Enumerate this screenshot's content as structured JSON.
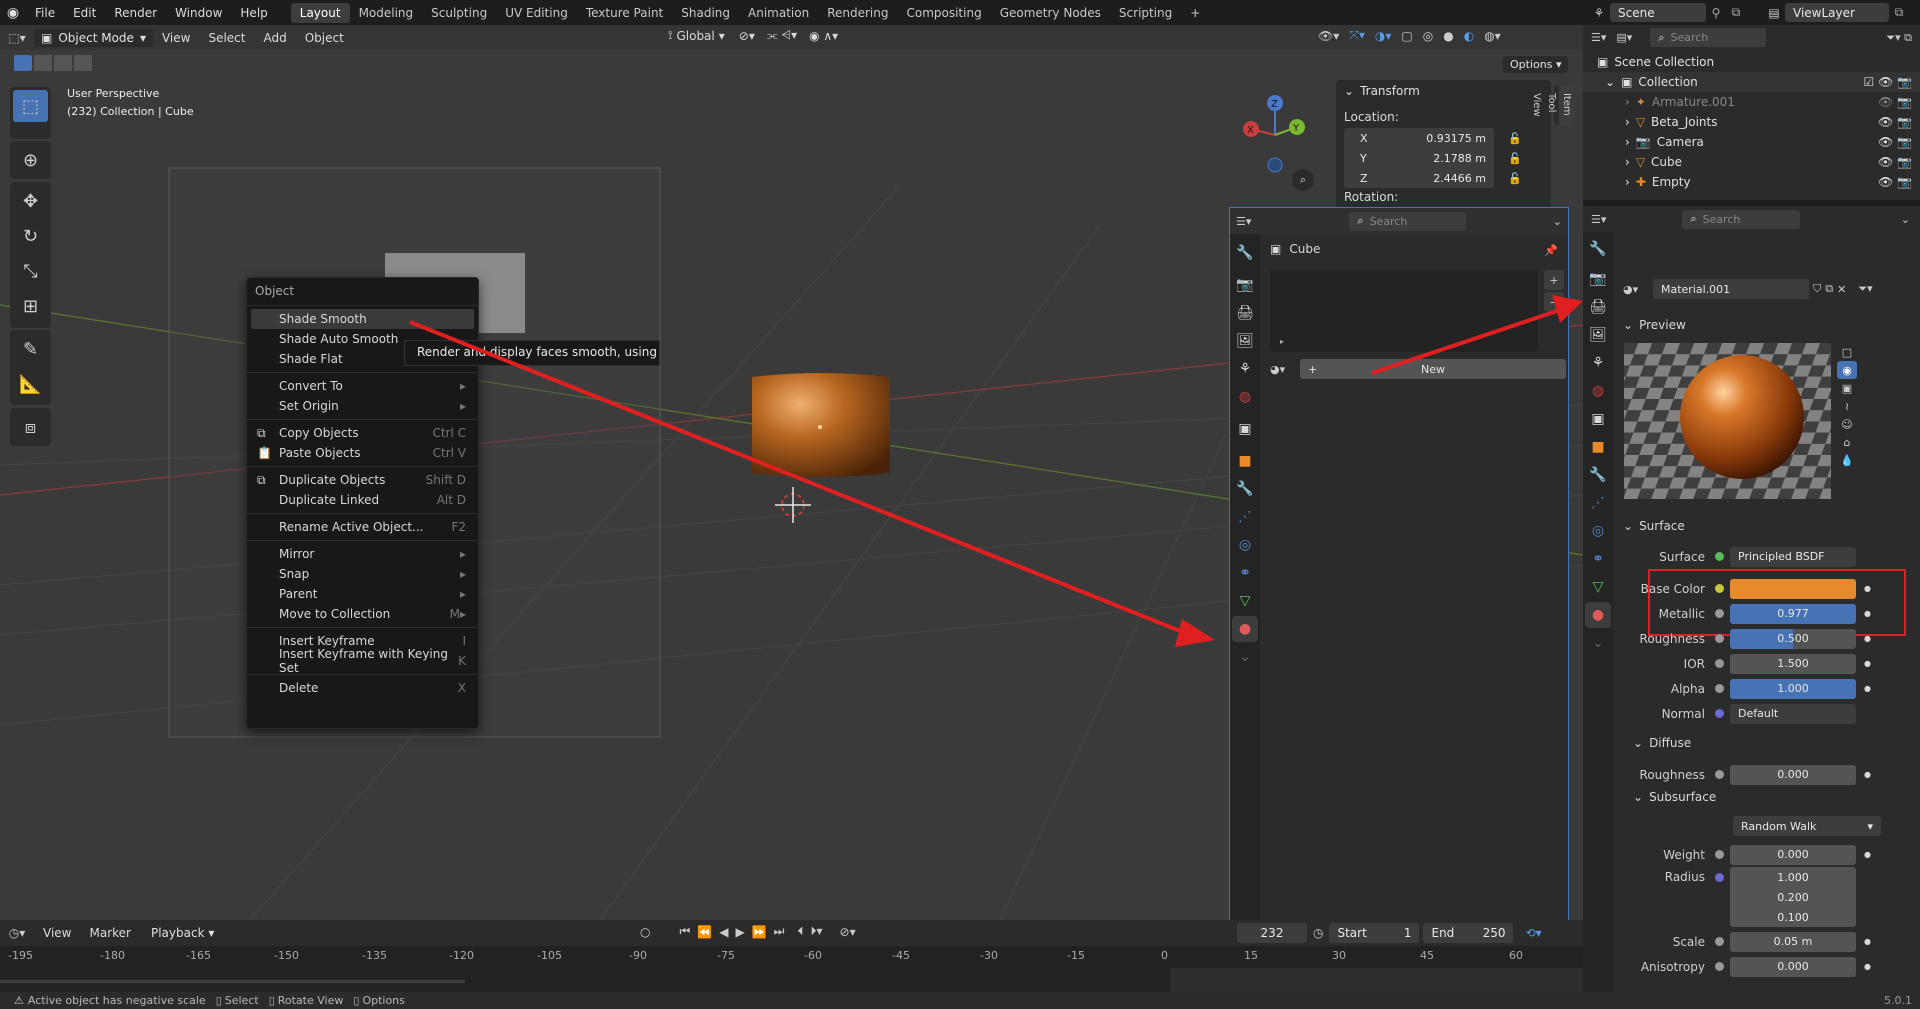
{
  "menu": {
    "items": [
      "File",
      "Edit",
      "Render",
      "Window",
      "Help"
    ],
    "workspaces": [
      "Layout",
      "Modeling",
      "Sculpting",
      "UV Editing",
      "Texture Paint",
      "Shading",
      "Animation",
      "Rendering",
      "Compositing",
      "Geometry Nodes",
      "Scripting"
    ],
    "active_workspace": "Layout",
    "scene": "Scene",
    "view_layer": "ViewLayer"
  },
  "viewport": {
    "mode": "Object Mode",
    "menus": [
      "View",
      "Select",
      "Add",
      "Object"
    ],
    "orientation": "Global",
    "options": "Options",
    "perspective": "User Perspective",
    "context": "(232) Collection | Cube"
  },
  "context_menu": {
    "title": "Object",
    "items": [
      {
        "label": "Shade Smooth",
        "shortcut": "",
        "submenu": false
      },
      {
        "label": "Shade Auto Smooth",
        "shortcut": "",
        "submenu": false
      },
      {
        "label": "Shade Flat",
        "shortcut": "",
        "submenu": false
      },
      {
        "label": "Convert To",
        "shortcut": "",
        "submenu": true
      },
      {
        "label": "Set Origin",
        "shortcut": "",
        "submenu": true
      },
      {
        "label": "Copy Objects",
        "shortcut": "Ctrl C",
        "submenu": false
      },
      {
        "label": "Paste Objects",
        "shortcut": "Ctrl V",
        "submenu": false
      },
      {
        "label": "Duplicate Objects",
        "shortcut": "Shift D",
        "submenu": false
      },
      {
        "label": "Duplicate Linked",
        "shortcut": "Alt D",
        "submenu": false
      },
      {
        "label": "Rename Active Object...",
        "shortcut": "F2",
        "submenu": false
      },
      {
        "label": "Mirror",
        "shortcut": "",
        "submenu": true
      },
      {
        "label": "Snap",
        "shortcut": "",
        "submenu": true
      },
      {
        "label": "Parent",
        "shortcut": "",
        "submenu": true
      },
      {
        "label": "Move to Collection",
        "shortcut": "M",
        "submenu": true
      },
      {
        "label": "Insert Keyframe",
        "shortcut": "I",
        "submenu": false
      },
      {
        "label": "Insert Keyframe with Keying Set",
        "shortcut": "K",
        "submenu": false
      },
      {
        "label": "Delete",
        "shortcut": "X",
        "submenu": false
      }
    ],
    "tooltip": "Render and display faces smooth, using interp"
  },
  "transform": {
    "header": "Transform",
    "location_label": "Location:",
    "x_label": "X",
    "x": "0.93175 m",
    "y_label": "Y",
    "y": "2.1788 m",
    "z_label": "Z",
    "z": "2.4466 m",
    "rotation_label": "Rotation:",
    "tabs": [
      "Item",
      "Tool",
      "View"
    ]
  },
  "mid_props": {
    "search": "Search",
    "object": "Cube",
    "new": "New"
  },
  "outliner": {
    "search": "Search",
    "root": "Scene Collection",
    "collection": "Collection",
    "items": [
      "Armature.001",
      "Beta_Joints",
      "Camera",
      "Cube",
      "Empty"
    ]
  },
  "material": {
    "search": "Search",
    "name": "Material.001",
    "preview": "Preview",
    "surface_header": "Surface",
    "surface_label": "Surface",
    "surface_value": "Principled BSDF",
    "base_color_label": "Base Color",
    "base_color": "#e68a2e",
    "metallic_label": "Metallic",
    "metallic": "0.977",
    "roughness_label": "Roughness",
    "roughness": "0.500",
    "ior_label": "IOR",
    "ior": "1.500",
    "alpha_label": "Alpha",
    "alpha": "1.000",
    "normal_label": "Normal",
    "normal": "Default",
    "diffuse_header": "Diffuse",
    "diffuse_roughness_label": "Roughness",
    "diffuse_roughness": "0.000",
    "subsurface_header": "Subsurface",
    "subsurface_method": "Random Walk",
    "weight_label": "Weight",
    "weight": "0.000",
    "radius_label": "Radius",
    "radius": [
      "1.000",
      "0.200",
      "0.100"
    ],
    "scale_label": "Scale",
    "scale": "0.05 m",
    "anisotropy_label": "Anisotropy",
    "anisotropy": "0.000"
  },
  "timeline": {
    "menus": [
      "View",
      "Marker",
      "Playback"
    ],
    "frame": "232",
    "start_label": "Start",
    "start": "1",
    "end_label": "End",
    "end": "250",
    "ticks": [
      "-195",
      "-180",
      "-165",
      "-150",
      "-135",
      "-120",
      "-105",
      "-90",
      "-75",
      "-60",
      "-45",
      "-30",
      "-15",
      "0",
      "15",
      "30",
      "45",
      "60"
    ]
  },
  "status": {
    "warning": "Active object has negative scale",
    "hints": [
      "Select",
      "Rotate View",
      "Options"
    ],
    "version": "5.0.1"
  }
}
